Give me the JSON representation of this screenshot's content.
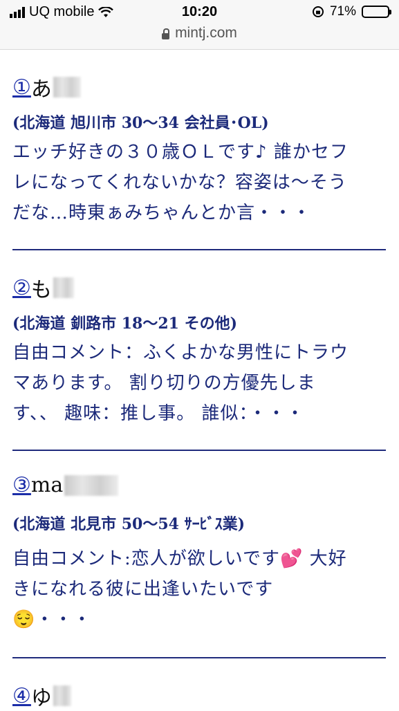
{
  "status_bar": {
    "carrier": "UQ mobile",
    "time": "10:20",
    "battery_percent": "71%",
    "battery_level": 0.71,
    "url": "mintj.com"
  },
  "posts": [
    {
      "number": "①",
      "name": "あ",
      "meta": "(北海道 旭川市 30〜34 会社員･OL)",
      "lines": [
        "エッチ好きの３０歳ＯＬです♪ 誰かセフ",
        "レになってくれないかな？容姿は〜そう",
        "だな…時東ぁみちゃんとか言・・・"
      ]
    },
    {
      "number": "②",
      "name": "も",
      "meta": "(北海道 釧路市 18〜21 その他)",
      "lines": [
        "自由コメント：ふくよかな男性にトラウ",
        "マあります。 割り切りの方優先しま",
        "す、、 趣味：推し事。 誰似：・・・"
      ]
    },
    {
      "number": "③",
      "name": "ma",
      "meta": "(北海道 北見市 50〜54 ｻｰﾋﾞｽ業)",
      "lines": [
        "自由コメント:恋人が欲しいです💕 大好",
        "きになれる彼に出逢いたいです",
        "😌・・・"
      ]
    },
    {
      "number": "④",
      "name": "ゆ"
    }
  ]
}
